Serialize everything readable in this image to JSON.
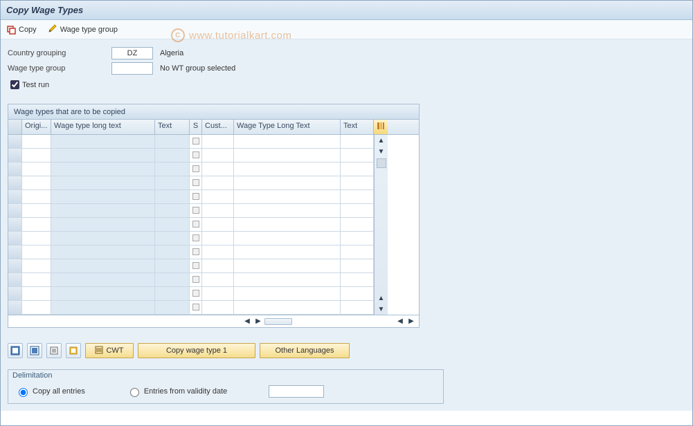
{
  "title": "Copy Wage Types",
  "toolbar": {
    "copy_label": "Copy",
    "wtg_label": "Wage type group"
  },
  "fields": {
    "country_grouping_label": "Country grouping",
    "country_grouping_value": "DZ",
    "country_grouping_desc": "Algeria",
    "wage_type_group_label": "Wage type group",
    "wage_type_group_value": "",
    "wage_type_group_desc": "No WT group selected",
    "test_run_label": "Test run",
    "test_run_checked": true
  },
  "table": {
    "group_title": "Wage types that are to be copied",
    "columns": {
      "origi": "Origi...",
      "wtlt_left": "Wage type long text",
      "text_left": "Text",
      "s": "S",
      "cust": "Cust...",
      "wtlt_right": "Wage Type Long Text",
      "text_right": "Text"
    },
    "row_count": 13
  },
  "actions": {
    "cwt_label": "CWT",
    "copy_wt1_label": "Copy wage type 1",
    "other_lang_label": "Other Languages"
  },
  "delimitation": {
    "box_label": "Delimitation",
    "copy_all_label": "Copy all entries",
    "entries_from_label": "Entries from validity date",
    "selection": "copy_all",
    "date_value": ""
  },
  "watermark": {
    "text": "www.tutorialkart.com"
  }
}
